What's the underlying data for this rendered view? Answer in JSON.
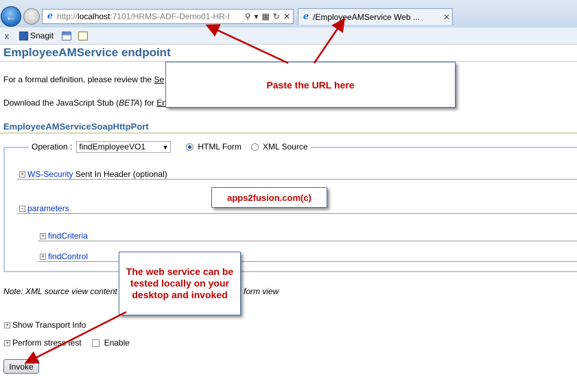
{
  "browser": {
    "url_prefix": "http://",
    "url_host": "localhost",
    "url_rest": ":7101/HRMS-ADF-Demo01-HR-I",
    "tab_label": "/EmployeeAMService Web ...",
    "toolbar_close": "x",
    "snagit_label": "Snagit"
  },
  "page": {
    "title": "EmployeeAMService endpoint",
    "definition_text": "For a formal definition, please review the ",
    "definition_link": "Se",
    "download_text": "Download the JavaScript Stub (",
    "download_beta": "BETA",
    "download_text2": ") for ",
    "download_link": "En",
    "port_title": "EmployeeAMServiceSoapHttpPort",
    "operation_label": "Operation :",
    "operation_value": "findEmployeeVO1",
    "radio_html": "HTML Form",
    "radio_xml": "XML Source",
    "ws_security_link": "WS-Security",
    "ws_security_text": "Sent In Header (optional)",
    "parameters_link": "parameters",
    "find_criteria_link": "findCriteria",
    "find_control_link": "findControl",
    "note_text": "Note: XML source view content",
    "note_tail": "form view",
    "show_transport": "Show Transport Info",
    "perform_stress": "Perform stress test",
    "enable_label": "Enable",
    "invoke_label": "Invoke"
  },
  "callouts": {
    "paste_url": "Paste the URL here",
    "web_service": "The web service can be tested locally on your desktop and invoked",
    "brand": "apps2fusion.com(c)"
  },
  "colors": {
    "title": "#336699",
    "callout_text": "#c00000",
    "arrow": "#c00000",
    "link": "#0033cc"
  }
}
